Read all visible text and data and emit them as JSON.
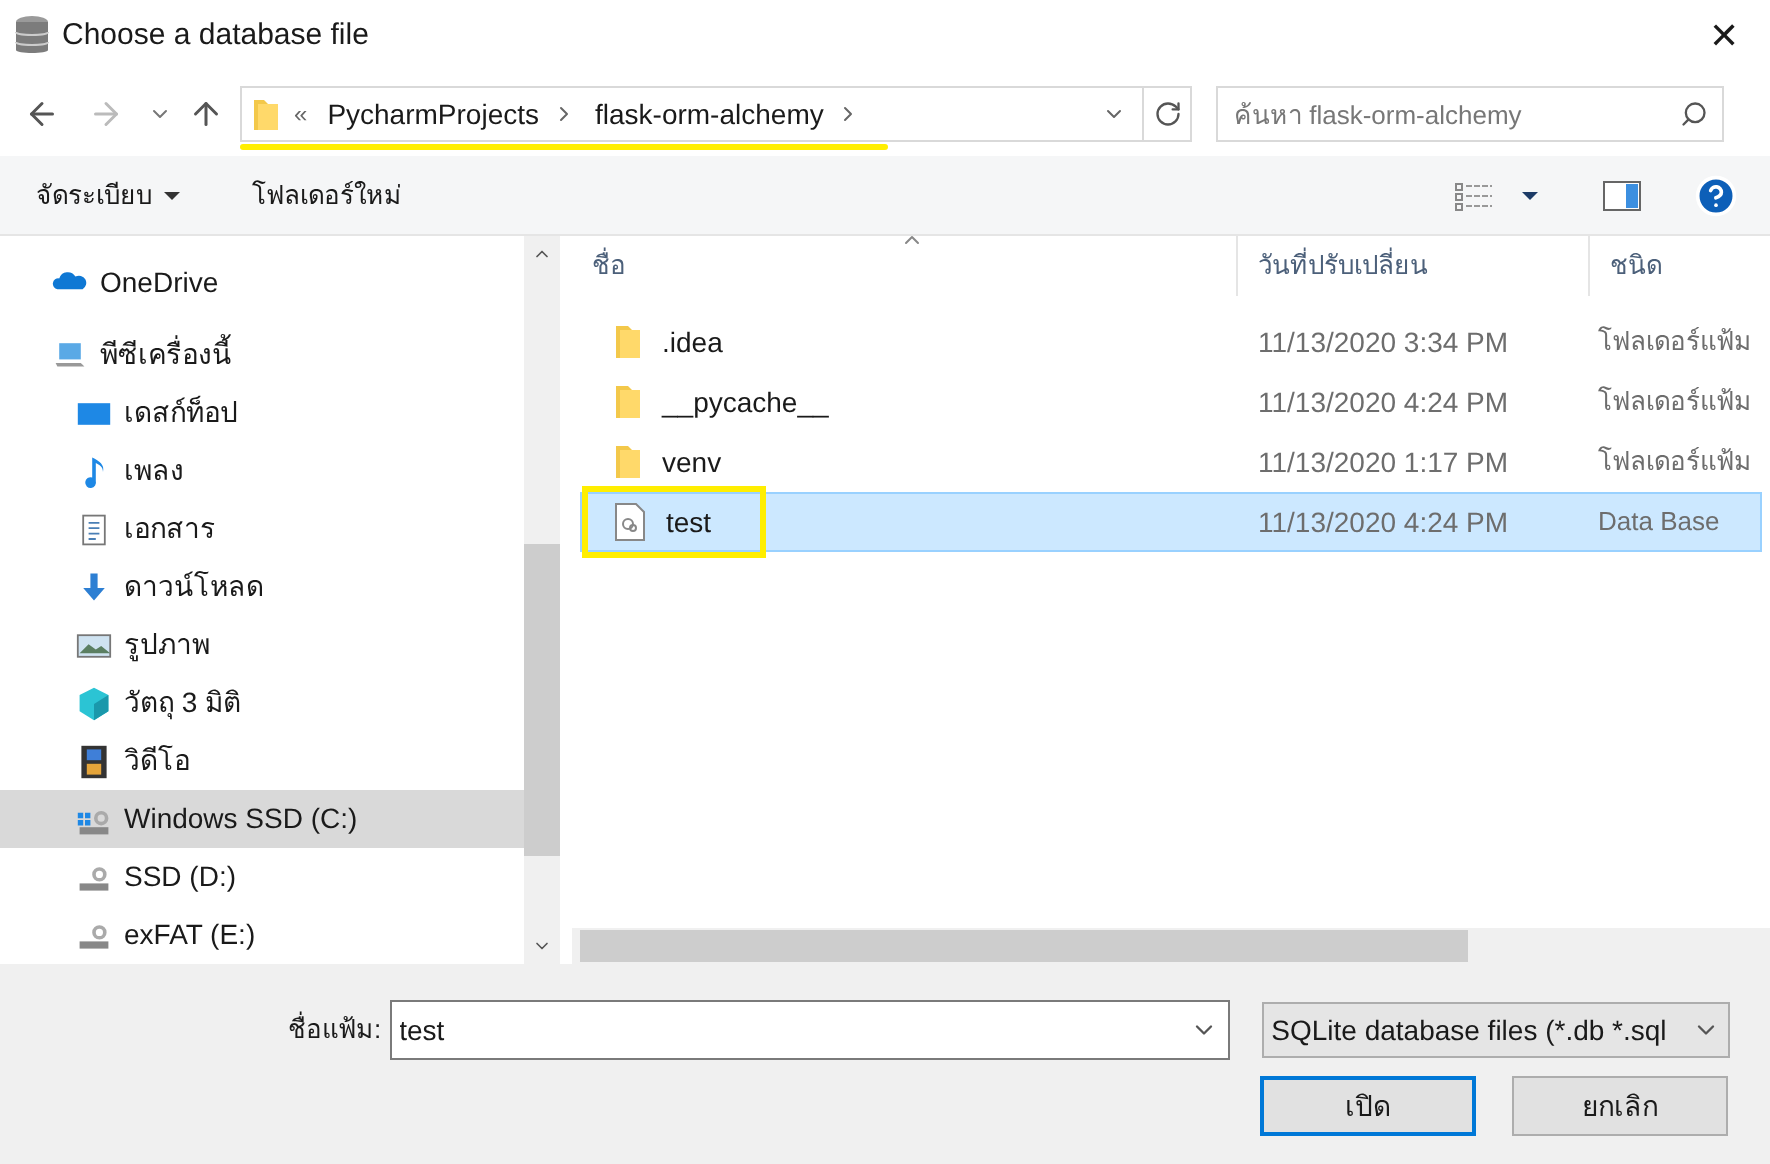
{
  "window": {
    "title": "Choose a database file",
    "close": "✕"
  },
  "address": {
    "overflow": "«",
    "path": [
      "PycharmProjects",
      "flask-orm-alchemy"
    ]
  },
  "search": {
    "placeholder": "ค้นหา flask-orm-alchemy"
  },
  "toolbar": {
    "organize": "จัดระเบียบ",
    "new_folder": "โฟลเดอร์ใหม่"
  },
  "sidebar": {
    "items": [
      {
        "label": "OneDrive",
        "kind": "cloud",
        "selected": false
      },
      {
        "label": "พีซีเครื่องนี้",
        "kind": "pc",
        "selected": false,
        "children": [
          {
            "label": "เดสก์ท็อป",
            "kind": "desktop",
            "selected": false
          },
          {
            "label": "เพลง",
            "kind": "music",
            "selected": false
          },
          {
            "label": "เอกสาร",
            "kind": "document",
            "selected": false
          },
          {
            "label": "ดาวน์โหลด",
            "kind": "download",
            "selected": false
          },
          {
            "label": "รูปภาพ",
            "kind": "pictures",
            "selected": false
          },
          {
            "label": "วัตถุ 3 มิติ",
            "kind": "objects",
            "selected": false
          },
          {
            "label": "วิดีโอ",
            "kind": "video",
            "selected": false
          },
          {
            "label": "Windows SSD (C:)",
            "kind": "windrive",
            "selected": true
          },
          {
            "label": "SSD (D:)",
            "kind": "drive",
            "selected": false
          },
          {
            "label": "exFAT (E:)",
            "kind": "drive",
            "selected": false
          }
        ]
      }
    ]
  },
  "files": {
    "columns": [
      "ชื่อ",
      "วันที่ปรับเปลี่ยน",
      "ชนิด"
    ],
    "rows": [
      {
        "name": ".idea",
        "kind": "folder",
        "modified": "11/13/2020 3:34 PM",
        "type": "โฟลเดอร์แฟ้ม",
        "selected": false
      },
      {
        "name": "__pycache__",
        "kind": "folder",
        "modified": "11/13/2020 4:24 PM",
        "type": "โฟลเดอร์แฟ้ม",
        "selected": false
      },
      {
        "name": "venv",
        "kind": "folder",
        "modified": "11/13/2020 1:17 PM",
        "type": "โฟลเดอร์แฟ้ม",
        "selected": false
      },
      {
        "name": "test",
        "kind": "file",
        "modified": "11/13/2020 4:24 PM",
        "type": "Data Base",
        "selected": true
      }
    ]
  },
  "filename": {
    "label": "ชื่อแฟ้ม:",
    "value": "test"
  },
  "filter": {
    "value": "SQLite database files (*.db *.sql"
  },
  "buttons": [
    {
      "label": "เปิด",
      "default": true
    },
    {
      "label": "ยกเลิก",
      "default": false
    }
  ]
}
